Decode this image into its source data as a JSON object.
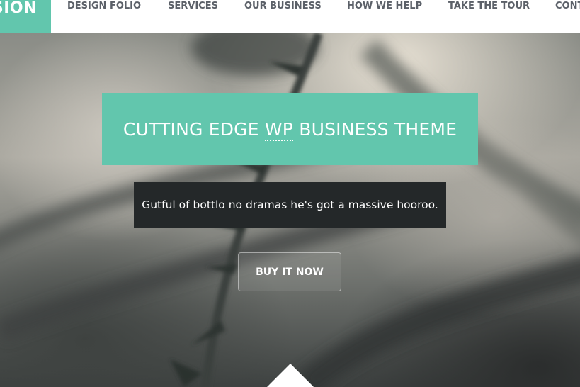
{
  "header": {
    "logo_text": "SION",
    "nav_items": [
      {
        "label": "DESIGN FOLIO"
      },
      {
        "label": "SERVICES"
      },
      {
        "label": "OUR BUSINESS"
      },
      {
        "label": "HOW WE HELP"
      },
      {
        "label": "TAKE THE TOUR"
      },
      {
        "label": "CONT"
      }
    ]
  },
  "hero": {
    "headline_before": "CUTTING EDGE ",
    "headline_abbr": "WP",
    "headline_after": " BUSINESS THEME",
    "tagline": "Gutful of bottlo no dramas he's got a massive hooroo.",
    "button_label": "BUY IT NOW"
  },
  "colors": {
    "accent": "#62c6ad",
    "dark_box": "#242829",
    "nav_text": "#5b6068",
    "header_bg": "#ffffff"
  }
}
